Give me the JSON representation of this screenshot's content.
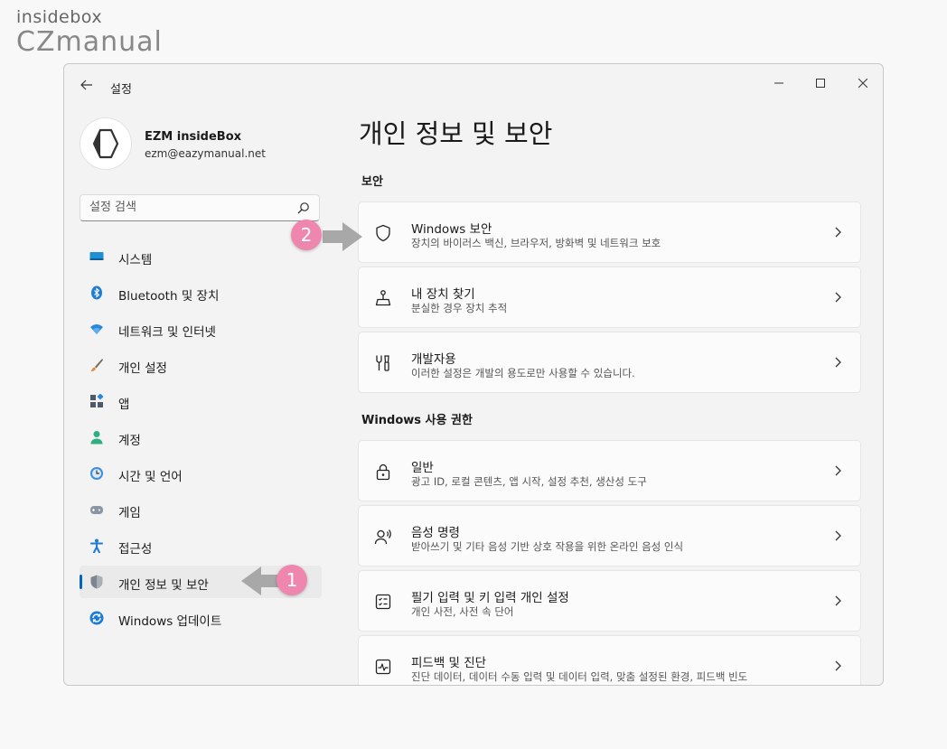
{
  "watermark": {
    "line1": "insidebox",
    "line2": "CZmanual"
  },
  "window": {
    "title": "설정"
  },
  "profile": {
    "name": "EZM insideBox",
    "email": "ezm@eazymanual.net"
  },
  "search": {
    "placeholder": "설정 검색"
  },
  "nav": {
    "items": [
      {
        "label": "시스템",
        "icon": "system-icon"
      },
      {
        "label": "Bluetooth 및 장치",
        "icon": "bluetooth-icon"
      },
      {
        "label": "네트워크 및 인터넷",
        "icon": "network-icon"
      },
      {
        "label": "개인 설정",
        "icon": "brush-icon"
      },
      {
        "label": "앱",
        "icon": "apps-icon"
      },
      {
        "label": "계정",
        "icon": "account-icon"
      },
      {
        "label": "시간 및 언어",
        "icon": "time-language-icon"
      },
      {
        "label": "게임",
        "icon": "gamepad-icon"
      },
      {
        "label": "접근성",
        "icon": "accessibility-icon"
      },
      {
        "label": "개인 정보 및 보안",
        "icon": "shield-icon",
        "selected": true
      },
      {
        "label": "Windows 업데이트",
        "icon": "update-icon"
      }
    ]
  },
  "main": {
    "title": "개인 정보 및 보안",
    "security_section": {
      "heading": "보안",
      "cards": [
        {
          "title": "Windows 보안",
          "desc": "장치의 바이러스 백신, 브라우저, 방화벽 및 네트워크 보호",
          "icon": "shield-outline-icon"
        },
        {
          "title": "내 장치 찾기",
          "desc": "분실한 경우 장치 추적",
          "icon": "find-device-icon"
        },
        {
          "title": "개발자용",
          "desc": "이러한 설정은 개발의 용도로만 사용할 수 있습니다.",
          "icon": "developer-tools-icon"
        }
      ]
    },
    "permissions_section": {
      "heading": "Windows 사용 권한",
      "cards": [
        {
          "title": "일반",
          "desc": "광고 ID, 로컬 콘텐츠, 앱 시작, 설정 추천, 생산성 도구",
          "icon": "lock-icon"
        },
        {
          "title": "음성 명령",
          "desc": "받아쓰기 및 기타 음성 기반 상호 작용을 위한 온라인 음성 인식",
          "icon": "speech-icon"
        },
        {
          "title": "필기 입력 및 키 입력 개인 설정",
          "desc": "개인 사전, 사전 속 단어",
          "icon": "inking-typing-icon"
        },
        {
          "title": "피드백 및 진단",
          "desc": "진단 데이터, 데이터 수동 입력 및 데이터 입력, 맞춤 설정된 환경, 피드백 빈도",
          "icon": "diagnostics-icon"
        }
      ]
    }
  },
  "annotations": [
    {
      "label": "1"
    },
    {
      "label": "2"
    }
  ],
  "colors": {
    "accent": "#0067c0",
    "badge": "#ee86ae",
    "arrow": "#a8a8a8"
  }
}
